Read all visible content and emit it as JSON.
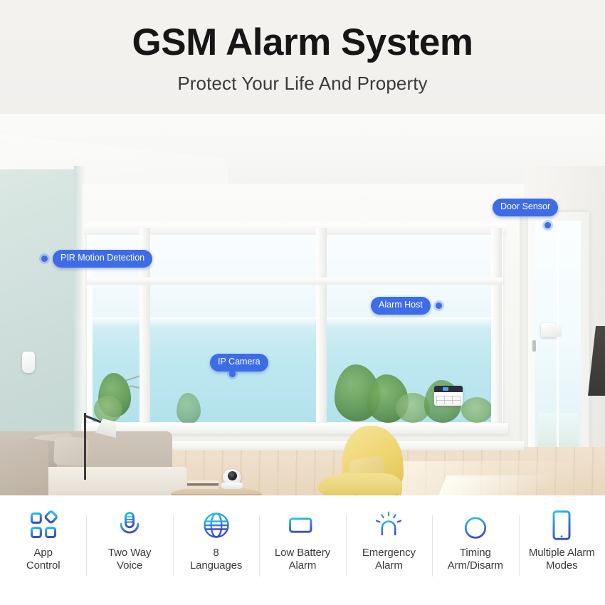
{
  "header": {
    "title": "GSM Alarm System",
    "subtitle": "Protect Your Life And Property"
  },
  "scene": {
    "description": "Modern living room with bay window ocean view",
    "callouts": [
      {
        "label": "PIR Motion Detection",
        "device": "pir-motion-sensor"
      },
      {
        "label": "Door Sensor",
        "device": "door-contact-sensor"
      },
      {
        "label": "Alarm Host",
        "device": "alarm-host-panel"
      },
      {
        "label": "IP Camera",
        "device": "ip-camera"
      }
    ]
  },
  "features": [
    {
      "label": "App\nControl",
      "line1": "App",
      "line2": "Control",
      "icon": "app-control-icon"
    },
    {
      "label": "Two Way Voice",
      "line1": "Two Way",
      "line2": "Voice",
      "icon": "microphone-icon"
    },
    {
      "label": "8 Languages",
      "line1": "8",
      "line2": "Languages",
      "icon": "globe-icon"
    },
    {
      "label": "Low Battery Alarm",
      "line1": "Low Battery",
      "line2": "Alarm",
      "icon": "battery-icon"
    },
    {
      "label": "Emergency Alarm",
      "line1": "Emergency",
      "line2": "Alarm",
      "icon": "siren-icon"
    },
    {
      "label": "Timing Arm/Disarm",
      "line1": "Timing",
      "line2": "Arm/Disarm",
      "icon": "stopwatch-icon"
    },
    {
      "label": "Multiple Alarm Modes",
      "line1": "Multiple Alarm",
      "line2": "Modes",
      "icon": "smartphone-icon"
    }
  ],
  "colors": {
    "pill_blue": "#3d6ce6",
    "icon_gradient_start": "#29c5e8",
    "icon_gradient_end": "#3b4fc4",
    "header_bg": "#f3f1ee",
    "title_text": "#161616",
    "label_text": "#3a3a3a",
    "wall_accent": "#cfdfdb"
  }
}
